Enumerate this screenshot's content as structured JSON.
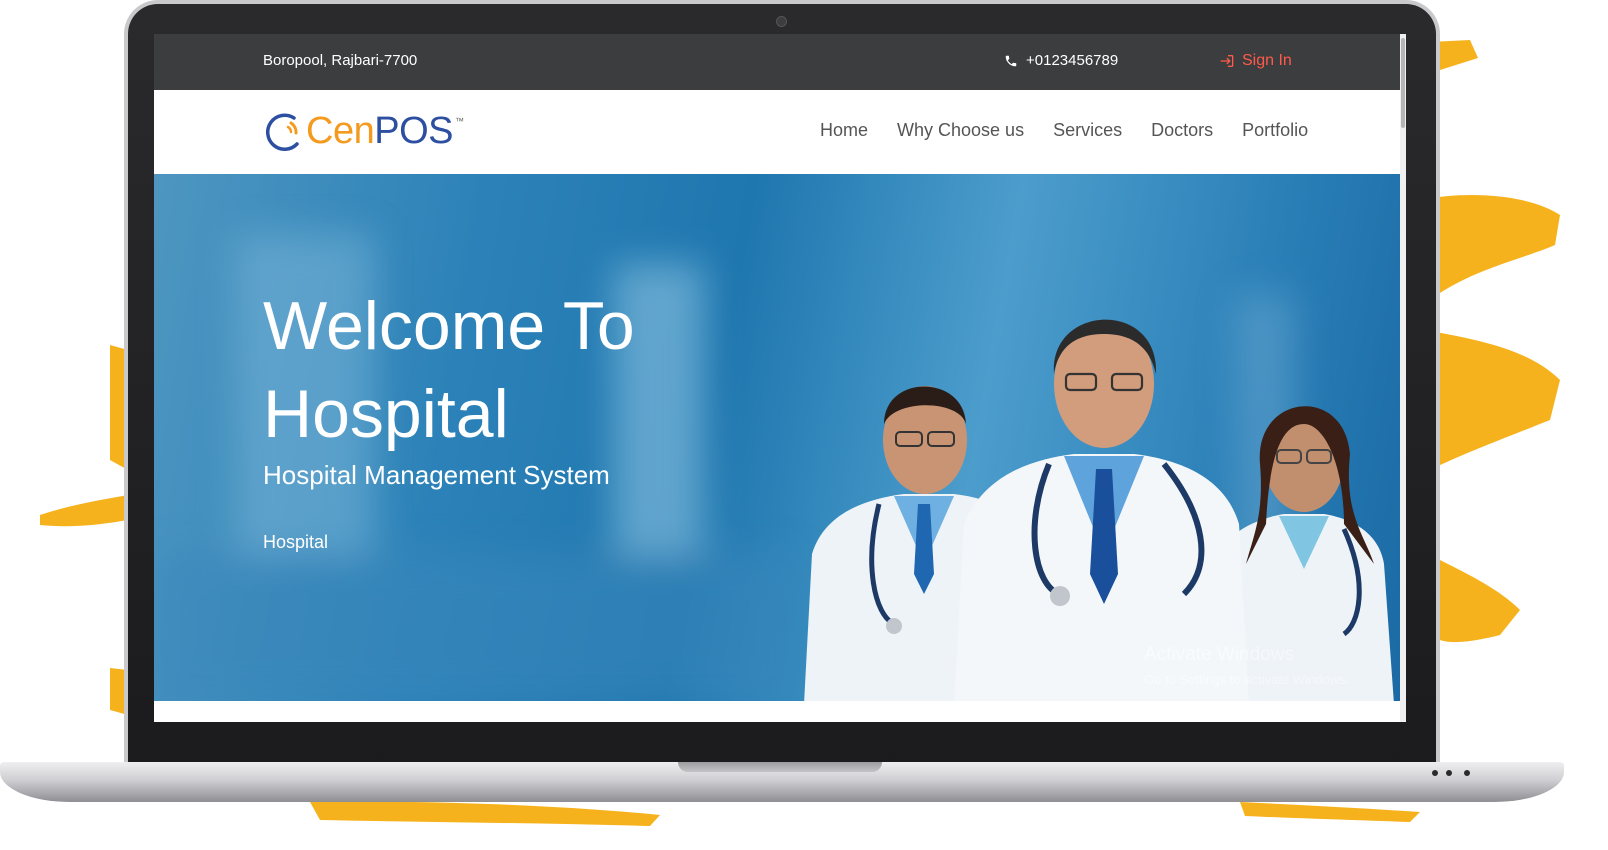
{
  "topbar": {
    "address": "Boropool, Rajbari-7700",
    "phone": "+0123456789",
    "signin_label": "Sign In"
  },
  "logo": {
    "brand_prefix": "Cen",
    "brand_suffix": "POS",
    "trademark": "™"
  },
  "nav": {
    "items": [
      "Home",
      "Why Choose us",
      "Services",
      "Doctors",
      "Portfolio"
    ]
  },
  "hero": {
    "title_line1": "Welcome To",
    "title_line2": "Hospital",
    "subtitle": "Hospital Management System",
    "tag": "Hospital"
  },
  "watermark": {
    "title": "Activate Windows",
    "subtitle": "Go to Settings to activate Windows."
  },
  "colors": {
    "accent_orange": "#f39a1f",
    "signin_red": "#ff5a4a",
    "brand_blue": "#2d4fa1",
    "topbar_bg": "#3b3d3f"
  },
  "icons": {
    "phone": "phone-icon",
    "signin": "sign-in-icon",
    "logo_mark": "logo-arc-icon"
  }
}
